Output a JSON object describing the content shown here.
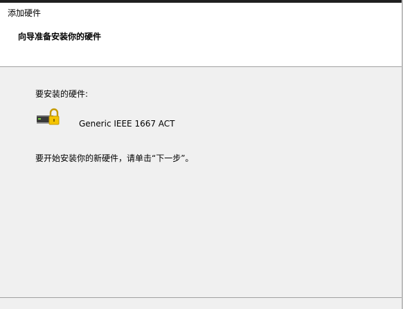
{
  "window": {
    "title": "添加硬件"
  },
  "header": {
    "title": "向导准备安装你的硬件"
  },
  "content": {
    "hardware_label": "要安装的硬件:",
    "device": {
      "icon": "hardware-device-lock-icon",
      "name": "Generic IEEE 1667 ACT"
    },
    "instruction": "要开始安装你的新硬件，请单击“下一步”。"
  },
  "colors": {
    "content_background": "#f0f0f0",
    "header_background": "#ffffff",
    "divider": "#a0a0a0",
    "lock_yellow": "#f5c400"
  }
}
